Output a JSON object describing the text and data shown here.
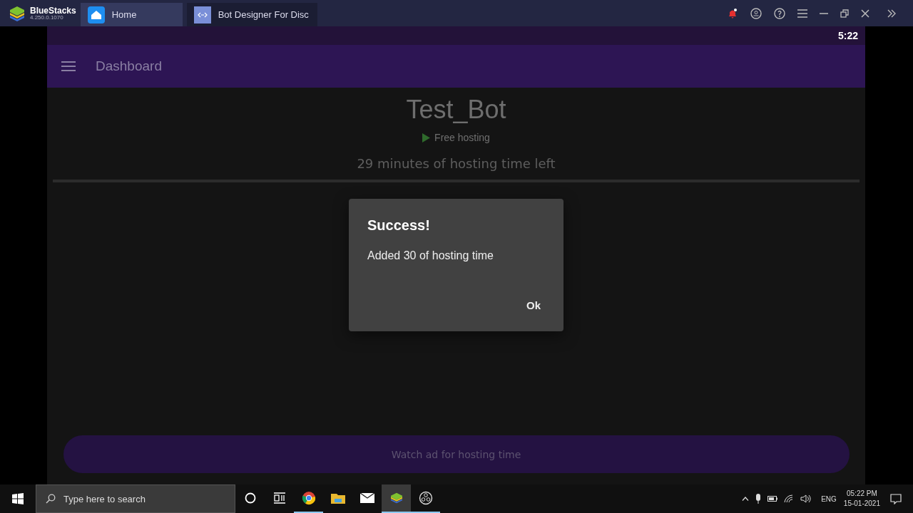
{
  "emulator": {
    "brand": "BlueStacks",
    "version": "4.250.0.1070",
    "tabs": [
      {
        "label": "Home",
        "kind": "home",
        "selected": false
      },
      {
        "label": "Bot Designer For Disc",
        "kind": "app",
        "selected": true
      }
    ]
  },
  "status_bar": {
    "time": "5:22"
  },
  "app_bar": {
    "title": "Dashboard"
  },
  "bot": {
    "name": "Test_Bot",
    "plan": "Free hosting",
    "time_left": "29 minutes of hosting time left"
  },
  "dialog": {
    "title": "Success!",
    "message": "Added 30 of hosting time",
    "button": "Ok"
  },
  "watch_ad_button": "Watch ad for hosting time",
  "taskbar": {
    "search_placeholder": "Type here to search",
    "apps": [
      {
        "kind": "cortana",
        "running": false,
        "selected": false
      },
      {
        "kind": "taskview",
        "running": false,
        "selected": false
      },
      {
        "kind": "chrome",
        "running": true,
        "selected": false
      },
      {
        "kind": "folder",
        "running": false,
        "selected": false
      },
      {
        "kind": "mail",
        "running": false,
        "selected": false
      },
      {
        "kind": "bluestacks",
        "running": true,
        "selected": true
      },
      {
        "kind": "obs",
        "running": true,
        "selected": false
      }
    ],
    "language": "ENG",
    "time": "05:22 PM",
    "date": "15-01-2021"
  }
}
